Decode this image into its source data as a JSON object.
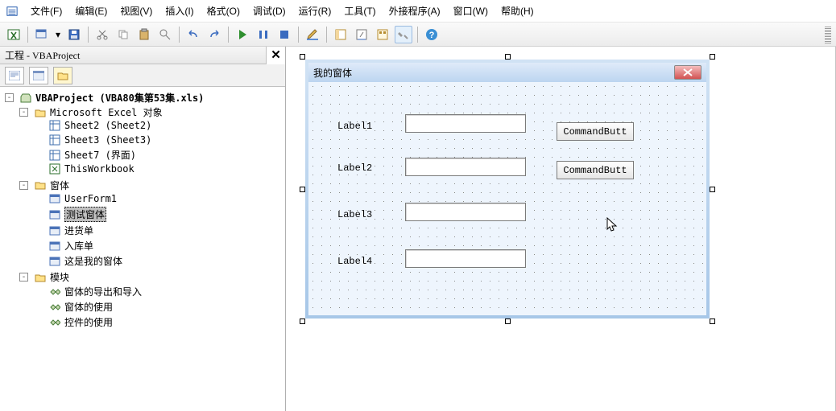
{
  "menu": {
    "items": [
      "文件(F)",
      "编辑(E)",
      "视图(V)",
      "插入(I)",
      "格式(O)",
      "调试(D)",
      "运行(R)",
      "工具(T)",
      "外接程序(A)",
      "窗口(W)",
      "帮助(H)"
    ]
  },
  "panel": {
    "title": "工程 - VBAProject",
    "close_glyph": "✕"
  },
  "tree": {
    "root": "VBAProject (VBA80集第53集.xls)",
    "groups": [
      {
        "label": "Microsoft Excel 对象",
        "items": [
          "Sheet2 (Sheet2)",
          "Sheet3 (Sheet3)",
          "Sheet7 (界面)",
          "ThisWorkbook"
        ]
      },
      {
        "label": "窗体",
        "items": [
          "UserForm1",
          "测试窗体",
          "进货单",
          "入库单",
          "这是我的窗体"
        ]
      },
      {
        "label": "模块",
        "items": [
          "窗体的导出和导入",
          "窗体的使用",
          "控件的使用"
        ]
      }
    ],
    "selected": "测试窗体"
  },
  "form": {
    "title": "我的窗体",
    "labels": [
      "Label1",
      "Label2",
      "Label3",
      "Label4"
    ],
    "buttons": [
      "CommandButt",
      "CommandButt"
    ]
  }
}
